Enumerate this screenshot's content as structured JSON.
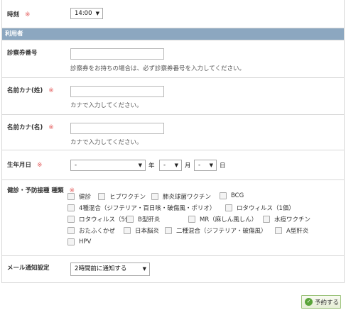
{
  "required_mark": "※",
  "time": {
    "label": "時刻",
    "value": "14:00"
  },
  "section_user": {
    "title": "利用者"
  },
  "card_number": {
    "label": "診察券番号",
    "value": "",
    "hint": "診察券をお持ちの場合は、必ず診察券番号を入力してください。"
  },
  "kana_last": {
    "label": "名前カナ(姓)",
    "value": "",
    "hint": "カナで入力してください。"
  },
  "kana_first": {
    "label": "名前カナ(名)",
    "value": "",
    "hint": "カナで入力してください。"
  },
  "birthday": {
    "label": "生年月日",
    "year": "-",
    "year_unit": "年",
    "month": "-",
    "month_unit": "月",
    "day": "-",
    "day_unit": "日"
  },
  "checkup": {
    "label": "健診・予防接種 種類",
    "options": [
      "健診",
      "ヒブワクチン",
      "肺炎球菌ワクチン",
      "BCG",
      "4種混合（ジフテリア・百日咳・破傷風・ポリオ）",
      "ロタウィルス（1価）",
      "ロタウィルス（5価）",
      "B型肝炎",
      "MR（麻しん風しん）",
      "水痘ワクチン",
      "おたふくかぜ",
      "日本脳炎",
      "二種混合（ジフテリア・破傷風）",
      "A型肝炎",
      "HPV"
    ]
  },
  "mail": {
    "label": "メール通知設定",
    "value": "2時間前に通知する"
  },
  "submit": {
    "label": "予約する",
    "icon": "check-circle-icon"
  },
  "colors": {
    "section_header": "#8ca7c0",
    "required": "#e35a5a",
    "submit_icon": "#5aa43a"
  },
  "icons": {
    "select_arrow": "▼",
    "check": "✓"
  }
}
